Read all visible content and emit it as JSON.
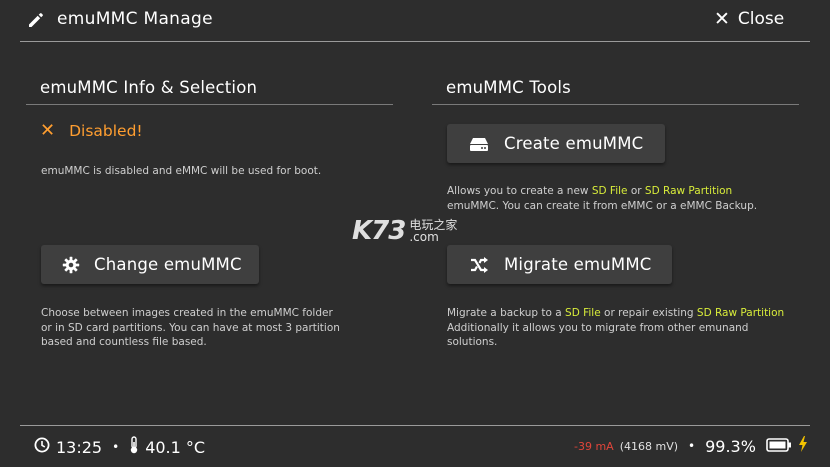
{
  "header": {
    "title": "emuMMC Manage",
    "title_icon": "pencil-icon",
    "close_label": "Close"
  },
  "left": {
    "section_title": "emuMMC Info & Selection",
    "status_text": "Disabled!",
    "status_color": "#ff9e30",
    "status_desc": "emuMMC is disabled and eMMC will be used for boot.",
    "change_button": "Change emuMMC",
    "change_desc_1": "Choose between images created in the emuMMC folder",
    "change_desc_2": "or in SD card partitions. You can have at most 3 partition",
    "change_desc_3": "based and countless file based."
  },
  "right": {
    "section_title": "emuMMC Tools",
    "create_button": "Create emuMMC",
    "create_desc_a": "Allows you to create a new ",
    "create_desc_hl1": "SD File",
    "create_desc_b": " or ",
    "create_desc_hl2": "SD Raw Partition",
    "create_desc_2": "emuMMC. You can create it from eMMC or a eMMC Backup.",
    "migrate_button": "Migrate emuMMC",
    "migrate_desc_a": "Migrate a backup to a ",
    "migrate_desc_hl1": "SD File",
    "migrate_desc_b": " or repair existing ",
    "migrate_desc_hl2": "SD Raw Partition",
    "migrate_desc_2": "Additionally it allows you to migrate from other emunand",
    "migrate_desc_3": "solutions."
  },
  "watermark": {
    "main": "K73",
    "sub_top": "电玩之家",
    "sub_bottom": ".com"
  },
  "footer": {
    "time": "13:25",
    "temperature": "40.1 °C",
    "current": "-39 mA",
    "voltage": "(4168 mV)",
    "battery": "99.3%",
    "separator": "•"
  },
  "colors": {
    "background": "#2d2d2d",
    "accent_orange": "#ff9e30",
    "highlight_yellow": "#d8ec3a",
    "current_red": "#e0453a",
    "charging_yellow": "#f2c200"
  }
}
